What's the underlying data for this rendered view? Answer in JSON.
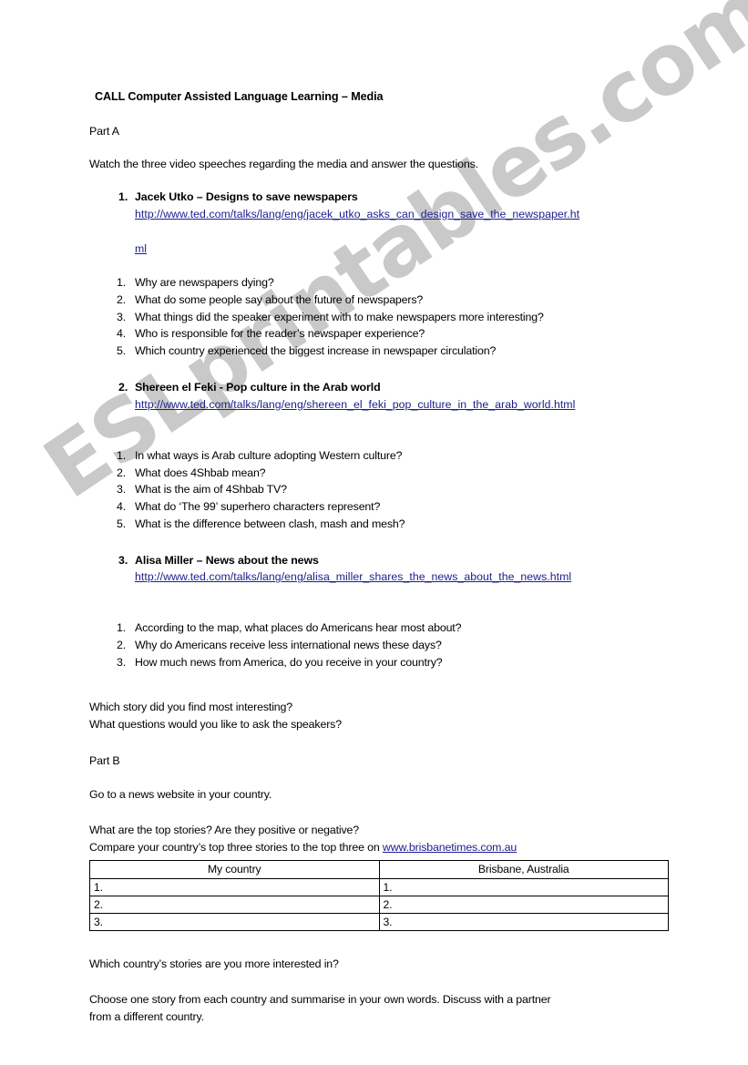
{
  "watermark": {
    "text": "ESLprintables.com"
  },
  "document": {
    "title": "CALL Computer Assisted Language Learning –  Media",
    "part_a": {
      "label": "Part A",
      "instruction": "Watch the three video speeches regarding the media and answer the questions.",
      "talks": [
        {
          "num": "1.",
          "title": "Jacek Utko – Designs to save newspapers",
          "url_line1": "http://www.ted.com/talks/lang/eng/jacek_utko_asks_can_design_save_the_newspaper.ht",
          "url_line2": "ml",
          "questions": [
            {
              "num": "1.",
              "text": "Why are newspapers dying?"
            },
            {
              "num": "2.",
              "text": "What do some people say about the future of newspapers?"
            },
            {
              "num": "3.",
              "text": "What things did the speaker experiment with to make newspapers more interesting?"
            },
            {
              "num": "4.",
              "text": "Who is responsible for the reader’s newspaper experience?"
            },
            {
              "num": "5.",
              "text": "Which country experienced the biggest increase in newspaper circulation?"
            }
          ]
        },
        {
          "num": "2.",
          "title": "Shereen el Feki  - Pop culture in the Arab world",
          "url_line1": "http://www.ted.com/talks/lang/eng/shereen_el_feki_pop_culture_in_the_arab_world.html",
          "url_line2": "",
          "questions": [
            {
              "num": "1.",
              "text": "In what ways is Arab culture adopting Western culture?"
            },
            {
              "num": "2.",
              "text": "What does 4Shbab mean?"
            },
            {
              "num": "3.",
              "text": "What is the aim of 4Shbab TV?"
            },
            {
              "num": "4.",
              "text": "What do ‘The 99’ superhero characters represent?"
            },
            {
              "num": "5.",
              "text": "What is the difference between clash, mash and mesh?"
            }
          ]
        },
        {
          "num": "3.",
          "title": "Alisa Miller – News about the news",
          "url_line1": "http://www.ted.com/talks/lang/eng/alisa_miller_shares_the_news_about_the_news.html",
          "url_line2": "",
          "questions": [
            {
              "num": "1.",
              "text": "According to the map, what places do Americans hear most about?"
            },
            {
              "num": "2.",
              "text": "Why do Americans receive less international news these days?"
            },
            {
              "num": "3.",
              "text": "How much news from America, do you receive in your country?"
            }
          ]
        }
      ],
      "closing_q1": "Which story did you find most interesting?",
      "closing_q2": "What questions would you like to ask the speakers?"
    },
    "part_b": {
      "label": "Part B",
      "instruction": "Go to a news website in your country.",
      "question1": "What are the top stories? Are they positive or negative?",
      "compare_prefix": "Compare your country’s  top three stories to the top three on ",
      "compare_link": "www.brisbanetimes.com.au",
      "table": {
        "headers": [
          "My country",
          "Brisbane, Australia"
        ],
        "rows": [
          [
            "1.",
            "1."
          ],
          [
            "2.",
            "2."
          ],
          [
            "3.",
            "3."
          ]
        ]
      },
      "question2": "Which country’s stories are you more interested in?",
      "final_line1": "Choose one story from each country and summarise in your own words.    Discuss with a partner",
      "final_line2": "from a different country."
    }
  },
  "colors": {
    "link": "#1c1c8f",
    "watermark": "#c9c9c9",
    "text": "#000000"
  }
}
